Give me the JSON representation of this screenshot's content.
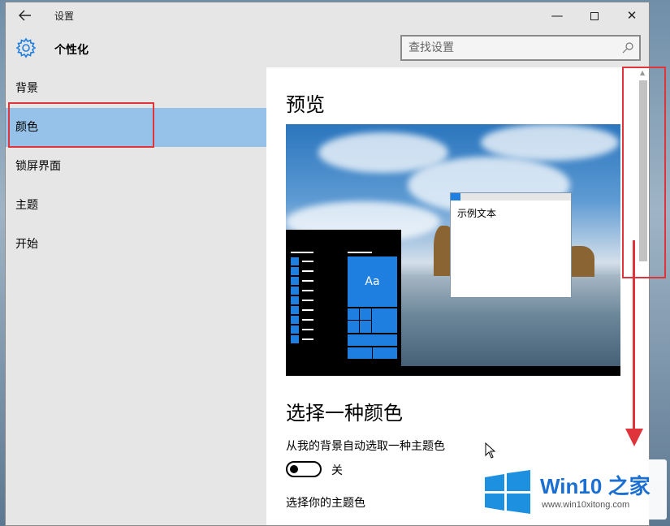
{
  "window": {
    "title": "设置",
    "back_icon": "back-arrow-icon",
    "controls": {
      "minimize": "—",
      "close": "✕"
    }
  },
  "header": {
    "section": "个性化",
    "search_placeholder": "查找设置"
  },
  "sidebar": {
    "items": [
      {
        "label": "背景",
        "active": false
      },
      {
        "label": "颜色",
        "active": true
      },
      {
        "label": "锁屏界面",
        "active": false
      },
      {
        "label": "主题",
        "active": false
      },
      {
        "label": "开始",
        "active": false
      }
    ]
  },
  "content": {
    "preview_heading": "预览",
    "preview": {
      "tile_label": "Aa",
      "sample_window_text": "示例文本"
    },
    "choose_heading": "选择一种颜色",
    "auto_pick_label": "从我的背景自动选取一种主题色",
    "auto_pick_toggle_state": "关",
    "accent_label": "选择你的主题色"
  },
  "colors": {
    "accent": "#1e7fe0",
    "selection": "#96c2e9",
    "annotation": "#e0343b"
  },
  "watermark": {
    "title_main": "Win10",
    "title_suffix": "之家",
    "url": "www.win10xitong.com"
  }
}
